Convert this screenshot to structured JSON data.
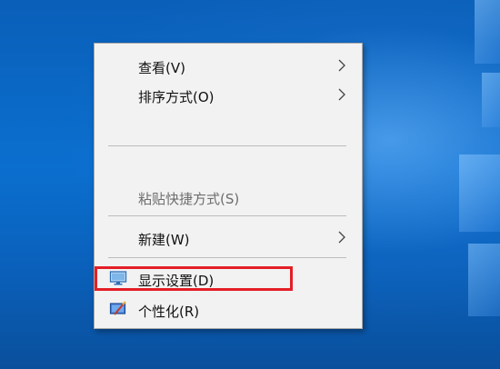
{
  "context_menu": {
    "items": [
      {
        "label": "查看(V)",
        "has_submenu": true,
        "enabled": true
      },
      {
        "label": "排序方式(O)",
        "has_submenu": true,
        "enabled": true
      },
      {
        "label": "粘贴快捷方式(S)",
        "has_submenu": false,
        "enabled": false
      },
      {
        "label": "新建(W)",
        "has_submenu": true,
        "enabled": true
      },
      {
        "label": "显示设置(D)",
        "has_submenu": false,
        "enabled": true,
        "icon": "display-icon",
        "highlighted": true
      },
      {
        "label": "个性化(R)",
        "has_submenu": false,
        "enabled": true,
        "icon": "personalize-icon"
      }
    ]
  },
  "colors": {
    "desktop_blue": "#0b6fcf",
    "menu_background": "#f2f2f2",
    "highlight_border": "#e41e26"
  }
}
